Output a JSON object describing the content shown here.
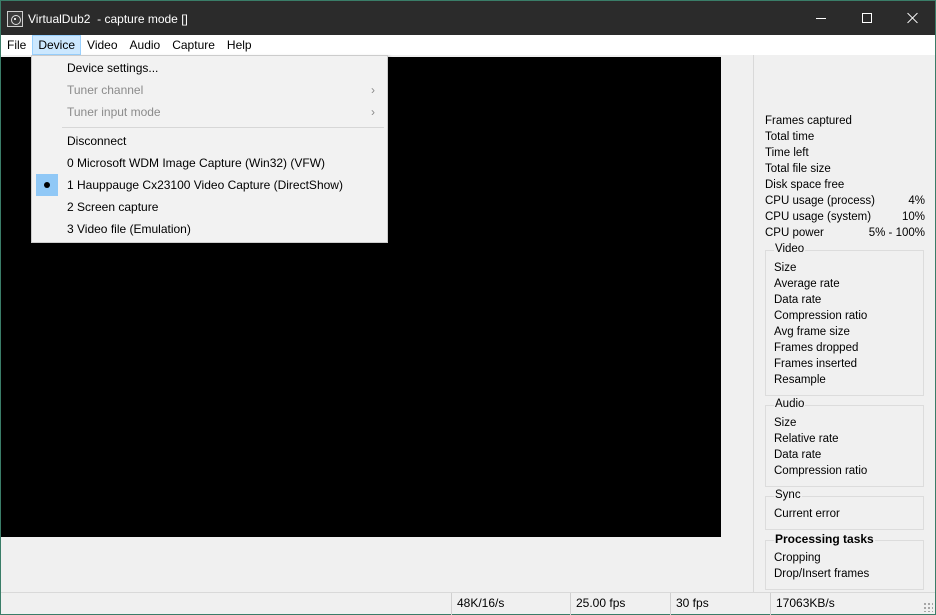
{
  "window": {
    "title": "VirtualDub2  - capture mode []"
  },
  "menubar": {
    "items": [
      {
        "label": "File",
        "active": false
      },
      {
        "label": "Device",
        "active": true
      },
      {
        "label": "Video",
        "active": false
      },
      {
        "label": "Audio",
        "active": false
      },
      {
        "label": "Capture",
        "active": false
      },
      {
        "label": "Help",
        "active": false
      }
    ]
  },
  "device_menu": {
    "items": [
      {
        "label": "Device settings...",
        "disabled": false
      },
      {
        "label": "Tuner channel",
        "disabled": true,
        "submenu": true
      },
      {
        "label": "Tuner input mode",
        "disabled": true,
        "submenu": true
      },
      {
        "label": "Disconnect",
        "disabled": false
      },
      {
        "label": "0 Microsoft WDM Image Capture (Win32) (VFW)",
        "disabled": false
      },
      {
        "label": "1 Hauppauge Cx23100 Video Capture (DirectShow)",
        "disabled": false,
        "checked": true
      },
      {
        "label": "2 Screen capture",
        "disabled": false
      },
      {
        "label": "3 Video file (Emulation)",
        "disabled": false
      }
    ],
    "submenu_arrow": "›"
  },
  "stats": {
    "frames_captured": {
      "label": "Frames captured",
      "value": ""
    },
    "total_time": {
      "label": "Total time",
      "value": ""
    },
    "time_left": {
      "label": "Time left",
      "value": ""
    },
    "total_file_size": {
      "label": "Total file size",
      "value": ""
    },
    "disk_space_free": {
      "label": "Disk space free",
      "value": ""
    },
    "cpu_process": {
      "label": "CPU usage (process)",
      "value": "4%"
    },
    "cpu_system": {
      "label": "CPU usage (system)",
      "value": "10%"
    },
    "cpu_power": {
      "label": "CPU power",
      "value": "5% - 100%"
    }
  },
  "video_group": {
    "title": "Video",
    "rows": [
      "Size",
      "Average rate",
      "Data rate",
      "Compression ratio",
      "Avg frame size",
      "Frames dropped",
      "Frames inserted",
      "Resample"
    ]
  },
  "audio_group": {
    "title": "Audio",
    "rows": [
      "Size",
      "Relative rate",
      "Data rate",
      "Compression ratio"
    ]
  },
  "sync_group": {
    "title": "Sync",
    "rows": [
      "Current error"
    ]
  },
  "processing_group": {
    "title": "Processing tasks",
    "rows": [
      "Cropping",
      "Drop/Insert frames"
    ]
  },
  "statusbar": {
    "audio_format": "48K/16/s",
    "frame_rate": "25.00 fps",
    "actual_fps": "30 fps",
    "data_rate": "17063KB/s"
  },
  "colors": {
    "titlebar": "#2b2b2b",
    "menu_highlight": "#cce8ff",
    "check_highlight": "#90c8f6",
    "preview": "#000000"
  }
}
